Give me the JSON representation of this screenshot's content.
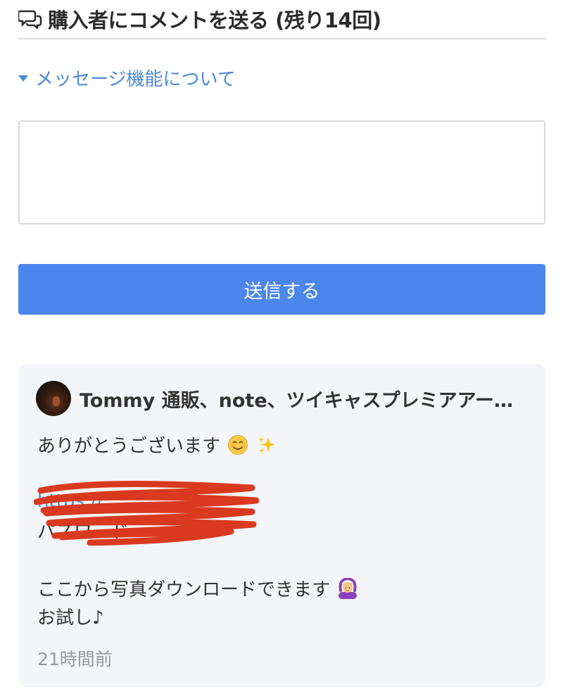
{
  "header": {
    "title": "購入者にコメントを送る (残り14回)",
    "icon": "chat-bubbles-icon"
  },
  "info_toggle": {
    "label": "メッセージ機能について",
    "icon": "triangle-down-icon"
  },
  "comment_input": {
    "value": "",
    "placeholder": ""
  },
  "send_button": {
    "label": "送信する"
  },
  "message": {
    "author": "Tommy 通販、note、ツイキャスプレミアアー…",
    "line1": "ありがとうございます",
    "line1_emojis": [
      "smiling-face-icon",
      "sparkles-icon"
    ],
    "link_text": "https://",
    "password_text": "パスワード",
    "line3": "ここから写真ダウンロードできます",
    "line3_emoji": "person-gesturing-ok-icon",
    "line4": "お試し♪",
    "timestamp": "21時間前"
  },
  "colors": {
    "accent": "#4a86ec",
    "link": "#4a88d8",
    "card_bg": "#f4f5f8",
    "redaction": "#d9391f"
  }
}
